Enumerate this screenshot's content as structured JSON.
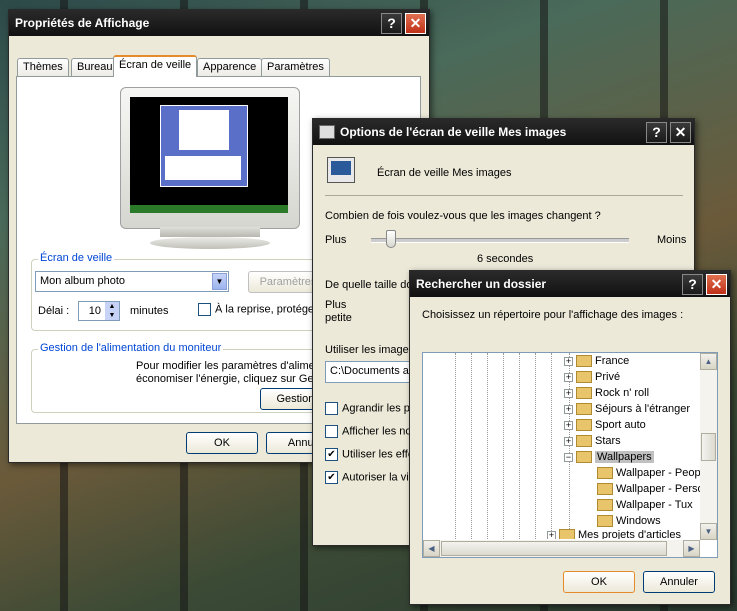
{
  "display_props": {
    "title": "Propriétés de Affichage",
    "tabs": [
      "Thèmes",
      "Bureau",
      "Écran de veille",
      "Apparence",
      "Paramètres"
    ],
    "screensaver_group": "Écran de veille",
    "screensaver_selected": "Mon album photo",
    "settings_button": "Paramètres",
    "delay_label": "Délai :",
    "delay_value": "10",
    "minutes_label": "minutes",
    "resume_label": "À la reprise, protéger",
    "power_group": "Gestion de l'alimentation du moniteur",
    "power_text_1": "Pour modifier les paramètres d'alimentat",
    "power_text_2": "économiser l'énergie, cliquez sur Gestic",
    "power_button": "Gestion d",
    "ok": "OK",
    "cancel": "Annul"
  },
  "screensaver_options": {
    "title": "Options de l'écran de veille Mes images",
    "header": "Écran de veille Mes images",
    "question": "Combien de fois voulez-vous que les images changent ?",
    "slider_min": "Plus",
    "slider_max": "Moins",
    "slider_value": "6 secondes",
    "size_question": "De quelle taille do",
    "size_min_1": "Plus",
    "size_min_2": "petite",
    "use_images": "Utiliser les images",
    "path": "C:\\Documents a",
    "cb_stretch": "Agrandir les pe",
    "cb_show_names": "Afficher les no",
    "cb_effects": "Utiliser les effe",
    "cb_allow": "Autoriser la vis",
    "slider_position": 0.06
  },
  "browse_folder": {
    "title": "Rechercher un dossier",
    "prompt": "Choisissez un répertoire pour l'affichage des images :",
    "items": [
      "France",
      "Privé",
      "Rock n' roll",
      "Séjours à l'étranger",
      "Sport auto",
      "Stars",
      "Wallpapers"
    ],
    "children": [
      "Wallpaper - Peop",
      "Wallpaper - Perso",
      "Wallpaper - Tux",
      "Windows"
    ],
    "last_item": "Mes projets d'articles",
    "ok": "OK",
    "cancel": "Annuler"
  }
}
